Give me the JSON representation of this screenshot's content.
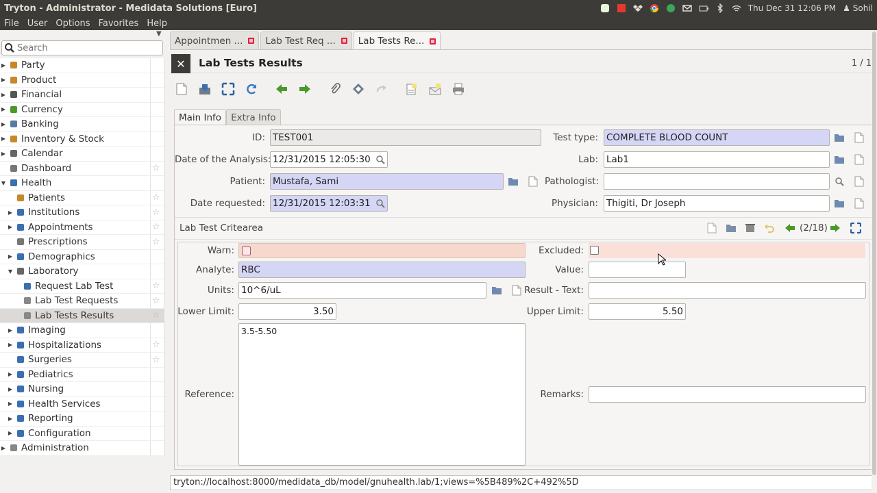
{
  "window": {
    "title": "Tryton - Administrator - Medidata Solutions [Euro]",
    "clock": "Thu Dec 31 12:06 PM",
    "user": "Sohil"
  },
  "menu": [
    "File",
    "User",
    "Options",
    "Favorites",
    "Help"
  ],
  "sidebar": {
    "search_placeholder": "Search",
    "items": [
      {
        "label": "Party",
        "level": 0,
        "expander": true,
        "icon": "party-icon",
        "star": false
      },
      {
        "label": "Product",
        "level": 0,
        "expander": true,
        "icon": "product-icon",
        "star": false
      },
      {
        "label": "Financial",
        "level": 0,
        "expander": true,
        "icon": "financial-icon",
        "star": false
      },
      {
        "label": "Currency",
        "level": 0,
        "expander": true,
        "icon": "currency-icon",
        "star": false
      },
      {
        "label": "Banking",
        "level": 0,
        "expander": true,
        "icon": "banking-icon",
        "star": false
      },
      {
        "label": "Inventory & Stock",
        "level": 0,
        "expander": true,
        "icon": "inventory-icon",
        "star": false
      },
      {
        "label": "Calendar",
        "level": 0,
        "expander": true,
        "icon": "calendar-icon",
        "star": false
      },
      {
        "label": "Dashboard",
        "level": 0,
        "expander": false,
        "icon": "dashboard-icon",
        "star": true
      },
      {
        "label": "Health",
        "level": 0,
        "expander": true,
        "expanded": true,
        "icon": "health-icon",
        "star": false
      },
      {
        "label": "Patients",
        "level": 1,
        "expander": false,
        "icon": "patients-icon",
        "star": true
      },
      {
        "label": "Institutions",
        "level": 1,
        "expander": true,
        "icon": "institutions-icon",
        "star": true
      },
      {
        "label": "Appointments",
        "level": 1,
        "expander": true,
        "icon": "appointments-icon",
        "star": true
      },
      {
        "label": "Prescriptions",
        "level": 1,
        "expander": false,
        "icon": "prescriptions-icon",
        "star": true
      },
      {
        "label": "Demographics",
        "level": 1,
        "expander": true,
        "icon": "demographics-icon",
        "star": false
      },
      {
        "label": "Laboratory",
        "level": 1,
        "expander": true,
        "expanded": true,
        "icon": "laboratory-icon",
        "star": false
      },
      {
        "label": "Request Lab Test",
        "level": 2,
        "expander": false,
        "icon": "request-lab-test-icon",
        "star": true
      },
      {
        "label": "Lab Test Requests",
        "level": 2,
        "expander": false,
        "icon": "lab-test-requests-icon",
        "star": true
      },
      {
        "label": "Lab Tests Results",
        "level": 2,
        "expander": false,
        "icon": "lab-tests-results-icon",
        "star": true,
        "selected": true
      },
      {
        "label": "Imaging",
        "level": 1,
        "expander": true,
        "icon": "imaging-icon",
        "star": false
      },
      {
        "label": "Hospitalizations",
        "level": 1,
        "expander": true,
        "icon": "hospitalizations-icon",
        "star": true
      },
      {
        "label": "Surgeries",
        "level": 1,
        "expander": false,
        "icon": "surgeries-icon",
        "star": true
      },
      {
        "label": "Pediatrics",
        "level": 1,
        "expander": true,
        "icon": "pediatrics-icon",
        "star": false
      },
      {
        "label": "Nursing",
        "level": 1,
        "expander": true,
        "icon": "nursing-icon",
        "star": false
      },
      {
        "label": "Health Services",
        "level": 1,
        "expander": true,
        "icon": "health-services-icon",
        "star": false
      },
      {
        "label": "Reporting",
        "level": 1,
        "expander": true,
        "icon": "reporting-icon",
        "star": false
      },
      {
        "label": "Configuration",
        "level": 1,
        "expander": true,
        "icon": "configuration-icon",
        "star": false
      },
      {
        "label": "Administration",
        "level": 0,
        "expander": true,
        "icon": "administration-icon",
        "star": false
      }
    ]
  },
  "tabs": [
    {
      "label": "Appointmen ...",
      "active": false
    },
    {
      "label": "Lab Test Req ...",
      "active": false
    },
    {
      "label": "Lab Tests Re...",
      "active": true
    }
  ],
  "header": {
    "title": "Lab Tests Results",
    "record_count": "1 / 1"
  },
  "form_tabs": [
    "Main Info",
    "Extra Info"
  ],
  "form": {
    "id_label": "ID:",
    "id_value": "TEST001",
    "test_type_label": "Test type:",
    "test_type_value": "COMPLETE BLOOD COUNT",
    "date_analysis_label": "Date of the Analysis:",
    "date_analysis_value": "12/31/2015 12:05:30",
    "lab_label": "Lab:",
    "lab_value": "Lab1",
    "patient_label": "Patient:",
    "patient_value": "Mustafa, Sami",
    "pathologist_label": "Pathologist:",
    "pathologist_value": "",
    "date_requested_label": "Date requested:",
    "date_requested_value": "12/31/2015 12:03:31",
    "physician_label": "Physician:",
    "physician_value": "Thigiti, Dr Joseph"
  },
  "criteria": {
    "title": "Lab Test Critearea",
    "pager": "(2/18)",
    "warn_label": "Warn:",
    "excluded_label": "Excluded:",
    "analyte_label": "Analyte:",
    "analyte_value": "RBC",
    "value_label": "Value:",
    "value_value": "",
    "units_label": "Units:",
    "units_value": "10^6/uL",
    "result_text_label": "Result - Text:",
    "result_text_value": "",
    "lower_limit_label": "Lower Limit:",
    "lower_limit_value": "3.50",
    "upper_limit_label": "Upper Limit:",
    "upper_limit_value": "5.50",
    "reference_label": "Reference:",
    "reference_value": "3.5-5.50",
    "remarks_label": "Remarks:",
    "remarks_value": ""
  },
  "status_url": "tryton://localhost:8000/medidata_db/model/gnuhealth.lab/1;views=%5B489%2C+492%5D",
  "colors": {
    "required_field": "#d5d6f5",
    "warn_field": "#f6d8cc",
    "titlebar": "#3c3b37"
  }
}
